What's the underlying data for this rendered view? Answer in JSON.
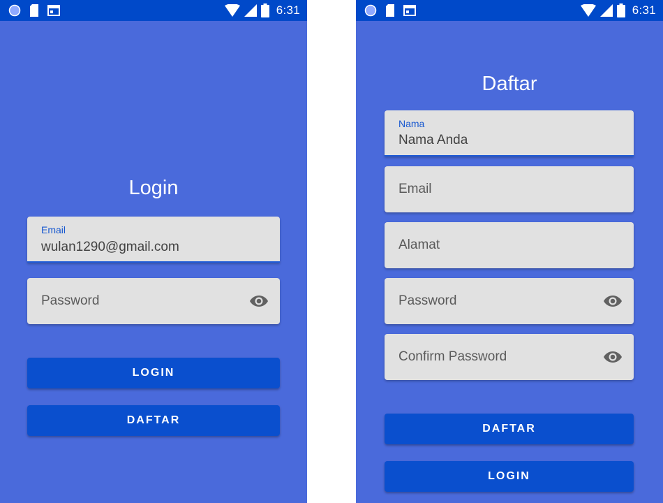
{
  "statusbar": {
    "time": "6:31",
    "left_icons": [
      "circle-icon",
      "sd-card-icon",
      "calendar-icon"
    ],
    "right_icons": [
      "wifi-icon",
      "signal-icon",
      "battery-icon"
    ]
  },
  "login_screen": {
    "title": "Login",
    "email_field": {
      "label": "Email",
      "value": "wulan1290@gmail.com"
    },
    "password_field": {
      "placeholder": "Password"
    },
    "login_button": "LOGIN",
    "register_button": "DAFTAR"
  },
  "register_screen": {
    "title": "Daftar",
    "name_field": {
      "label": "Nama",
      "value": "Nama Anda"
    },
    "email_field": {
      "placeholder": "Email"
    },
    "address_field": {
      "placeholder": "Alamat"
    },
    "password_field": {
      "placeholder": "Password"
    },
    "confirm_password_field": {
      "placeholder": "Confirm Password"
    },
    "register_button": "DAFTAR",
    "login_button": "LOGIN"
  },
  "colors": {
    "background": "#4a6adb",
    "statusbar": "#0049c9",
    "field": "#e1e1e1",
    "button": "#0a4fce",
    "accent": "#1657cf"
  }
}
